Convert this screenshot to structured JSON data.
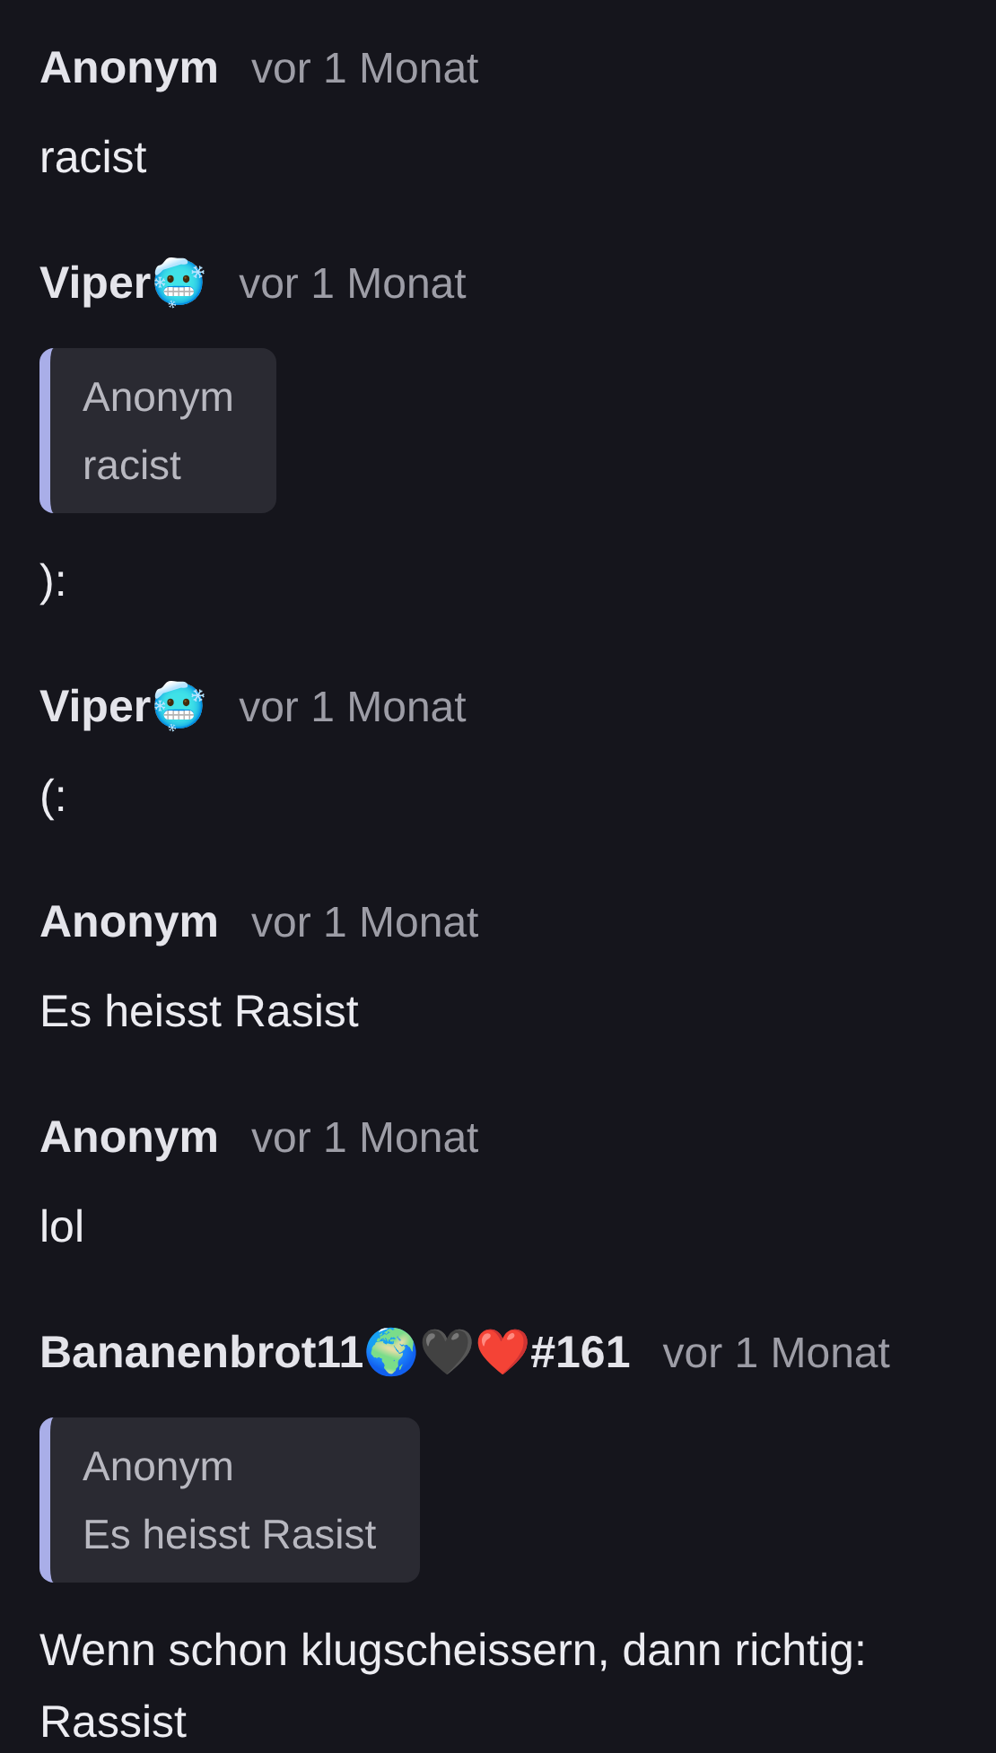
{
  "messages": [
    {
      "author": "Anonym",
      "time": "vor 1 Monat",
      "text": "racist"
    },
    {
      "author": "Viper🥶",
      "time": "vor 1 Monat",
      "quote": {
        "author": "Anonym",
        "text": "racist"
      },
      "text": "):"
    },
    {
      "author": "Viper🥶",
      "time": "vor 1 Monat",
      "text": "(:"
    },
    {
      "author": "Anonym",
      "time": "vor 1 Monat",
      "text": "Es heisst Rasist"
    },
    {
      "author": "Anonym",
      "time": "vor 1 Monat",
      "text": "lol"
    },
    {
      "author": "Bananenbrot11🌍🖤❤️#161",
      "time": "vor 1 Monat",
      "quote": {
        "author": "Anonym",
        "text": "Es heisst Rasist"
      },
      "text": "Wenn schon klugscheissern, dann richtig: Rassist"
    }
  ]
}
